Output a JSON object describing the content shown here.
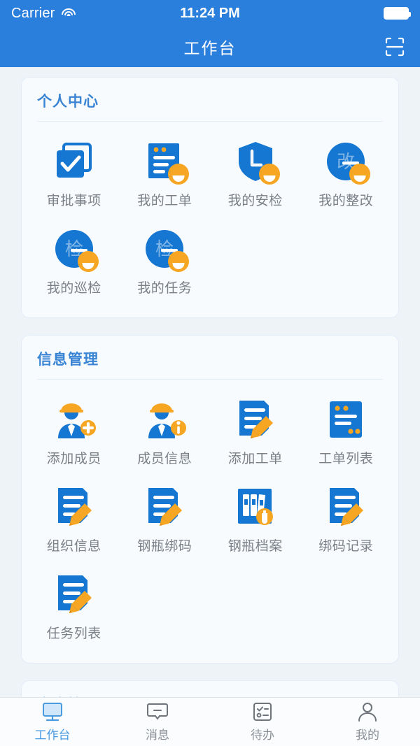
{
  "statusbar": {
    "carrier": "Carrier",
    "wifi_icon": "wifi-icon",
    "time": "11:24 PM",
    "battery_icon": "battery-full-icon"
  },
  "navbar": {
    "title": "工作台",
    "scan_icon": "scan-qr-icon"
  },
  "colors": {
    "primary": "#2a7fdc",
    "icon_blue": "#1677d2",
    "accent_orange": "#f6a623",
    "page_bg": "#eef3f8",
    "card_bg": "#f7fbfe",
    "label_gray": "#7b7f86",
    "tab_active": "#4a9ae0"
  },
  "sections": [
    {
      "title": "个人中心",
      "items": [
        {
          "label": "审批事项",
          "icon": "approval-check-icon",
          "badge": false
        },
        {
          "label": "我的工单",
          "icon": "work-order-doc-icon",
          "badge": true
        },
        {
          "label": "我的安检",
          "icon": "shield-safety-icon",
          "badge": true
        },
        {
          "label": "我的整改",
          "icon": "rectify-circle-icon",
          "badge": true,
          "glyph": "改"
        },
        {
          "label": "我的巡检",
          "icon": "inspection-circle-icon",
          "badge": true,
          "glyph": "检"
        },
        {
          "label": "我的任务",
          "icon": "task-circle-icon",
          "badge": true,
          "glyph": "检"
        }
      ]
    },
    {
      "title": "信息管理",
      "items": [
        {
          "label": "添加成员",
          "icon": "worker-add-icon",
          "badge": false
        },
        {
          "label": "成员信息",
          "icon": "worker-info-icon",
          "badge": false
        },
        {
          "label": "添加工单",
          "icon": "doc-pencil-icon",
          "badge": false
        },
        {
          "label": "工单列表",
          "icon": "doc-list-icon",
          "badge": false
        },
        {
          "label": "组织信息",
          "icon": "doc-pencil-icon",
          "badge": false
        },
        {
          "label": "钢瓶绑码",
          "icon": "doc-pencil-icon",
          "badge": false
        },
        {
          "label": "钢瓶档案",
          "icon": "cylinder-archive-icon",
          "badge": false
        },
        {
          "label": "绑码记录",
          "icon": "doc-pencil-icon",
          "badge": false
        },
        {
          "label": "任务列表",
          "icon": "doc-pencil-icon",
          "badge": false
        }
      ]
    },
    {
      "title": "客户管理",
      "items": []
    }
  ],
  "tabbar": {
    "items": [
      {
        "label": "工作台",
        "icon": "monitor-icon",
        "active": true
      },
      {
        "label": "消息",
        "icon": "chat-bubble-icon",
        "active": false
      },
      {
        "label": "待办",
        "icon": "checklist-icon",
        "active": false
      },
      {
        "label": "我的",
        "icon": "person-icon",
        "active": false
      }
    ]
  }
}
